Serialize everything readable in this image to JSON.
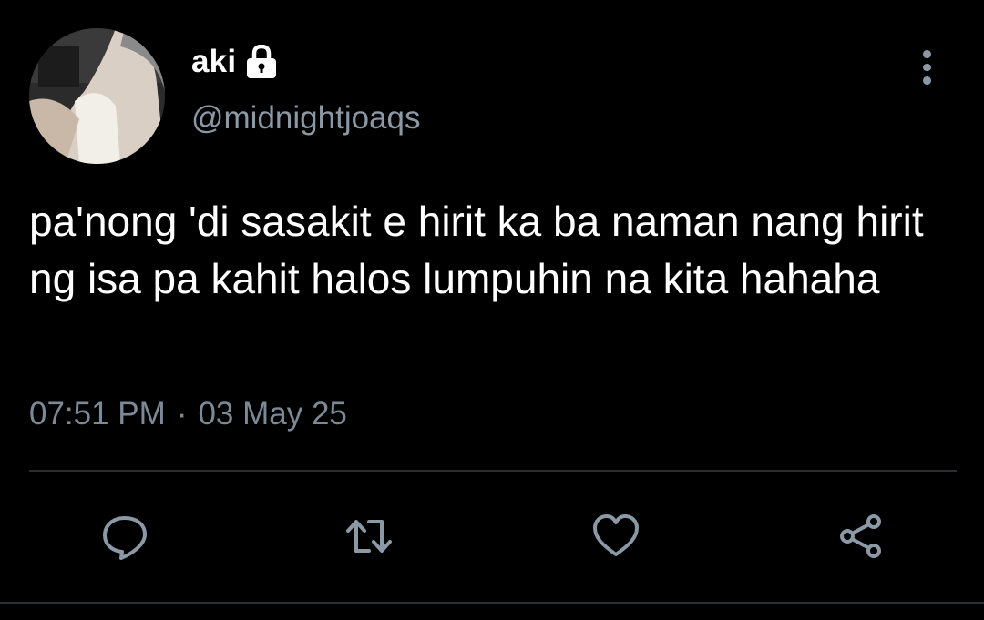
{
  "user": {
    "display_name": "aki",
    "handle": "@midnightjoaqs",
    "protected": true
  },
  "tweet": {
    "text": "pa'nong 'di sasakit e hirit ka ba naman nang hirit ng isa pa kahit halos lumpuhin na kita hahaha",
    "time": "07:51 PM",
    "separator": "·",
    "date": "03 May 25"
  },
  "actions": [
    {
      "name": "reply",
      "icon": "speech-bubble-icon"
    },
    {
      "name": "retweet",
      "icon": "retweet-arrows-icon"
    },
    {
      "name": "like",
      "icon": "heart-icon"
    },
    {
      "name": "share",
      "icon": "share-nodes-icon"
    }
  ],
  "colors": {
    "background": "#000000",
    "text_primary": "#ffffff",
    "text_secondary": "#8b98a5",
    "divider": "#2a2f33"
  }
}
